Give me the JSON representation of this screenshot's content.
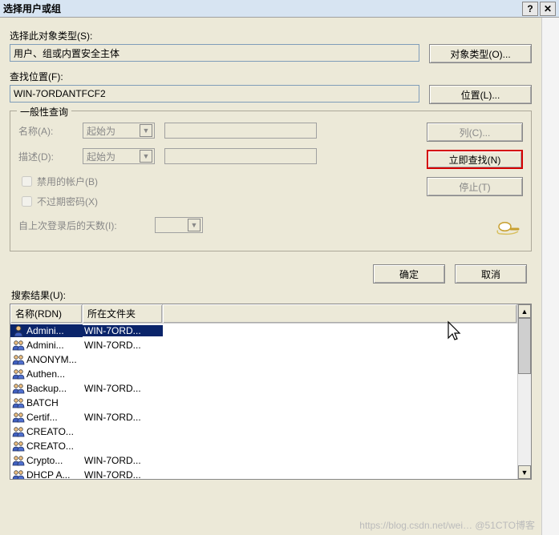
{
  "titlebar": {
    "title": "选择用户或组"
  },
  "section1": {
    "label": "选择此对象类型(S):",
    "value": "用户、组或内置安全主体",
    "btn": "对象类型(O)..."
  },
  "section2": {
    "label": "查找位置(F):",
    "value": "WIN-7ORDANTFCF2",
    "btn": "位置(L)..."
  },
  "fieldset": {
    "legend": "一般性查询",
    "name_label": "名称(A):",
    "name_combo": "起始为",
    "desc_label": "描述(D):",
    "desc_combo": "起始为",
    "chk_disabled": "禁用的帐户(B)",
    "chk_noexpire": "不过期密码(X)",
    "days_label": "自上次登录后的天数(I):"
  },
  "side": {
    "columns": "列(C)...",
    "findnow": "立即查找(N)",
    "stop": "停止(T)"
  },
  "ok": "确定",
  "cancel": "取消",
  "results_label": "搜索结果(U):",
  "columns": {
    "c0": "名称(RDN)",
    "c1": "所在文件夹"
  },
  "rows": [
    {
      "icon": "user",
      "name": "Admini...",
      "folder": "WIN-7ORD...",
      "sel": true
    },
    {
      "icon": "group",
      "name": "Admini...",
      "folder": "WIN-7ORD..."
    },
    {
      "icon": "group",
      "name": "ANONYM..."
    },
    {
      "icon": "group",
      "name": "Authen..."
    },
    {
      "icon": "group",
      "name": "Backup...",
      "folder": "WIN-7ORD..."
    },
    {
      "icon": "group",
      "name": "BATCH"
    },
    {
      "icon": "group",
      "name": "Certif...",
      "folder": "WIN-7ORD..."
    },
    {
      "icon": "group",
      "name": "CREATO..."
    },
    {
      "icon": "group",
      "name": "CREATO..."
    },
    {
      "icon": "group",
      "name": "Crypto...",
      "folder": "WIN-7ORD..."
    },
    {
      "icon": "group",
      "name": "DHCP A...",
      "folder": "WIN-7ORD..."
    }
  ],
  "watermark": "https://blog.csdn.net/wei…   @51CTO博客"
}
